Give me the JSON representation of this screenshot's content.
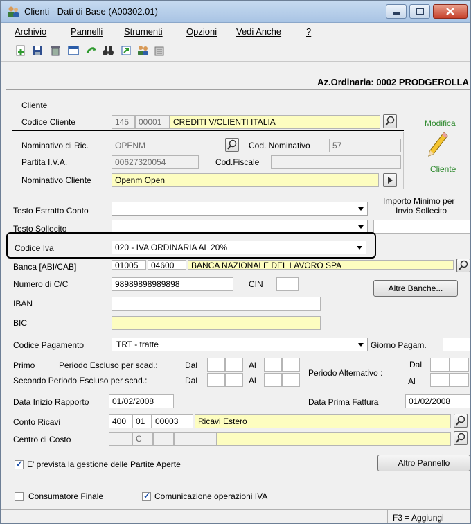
{
  "window": {
    "title": "Clienti - Dati di Base  (A00302.01)"
  },
  "menu": {
    "items": [
      "Archivio",
      "Pannelli",
      "Strumenti",
      "Opzioni",
      "Vedi Anche",
      "?"
    ]
  },
  "toolbar": {
    "icons": [
      "new-icon",
      "save-icon",
      "delete-icon",
      "window-icon",
      "refresh-icon",
      "binoculars-icon",
      "export-icon",
      "users-icon",
      "archive-icon"
    ]
  },
  "company": "Az.Ordinaria: 0002 PRODGEROLLA",
  "cliente": {
    "section_label": "Cliente",
    "codice_label": "Codice Cliente",
    "codice_1": "145",
    "codice_2": "00001",
    "codice_desc": "CREDITI V/CLIENTI ITALIA",
    "nominativo_ric_label": "Nominativo di Ric.",
    "nominativo_ric": "OPENM",
    "cod_nominativo_label": "Cod. Nominativo",
    "cod_nominativo": "57",
    "piva_label": "Partita I.V.A.",
    "piva": "00627320054",
    "codfiscale_label": "Cod.Fiscale",
    "codfiscale": "",
    "nominativo_cliente_label": "Nominativo Cliente",
    "nominativo_cliente": "Openm Open",
    "modifica_label": "Modifica",
    "cliente_label": "Cliente"
  },
  "form": {
    "estratto_label": "Testo Estratto Conto",
    "estratto_value": "",
    "importo_label_1": "Importo Minimo per",
    "importo_label_2": "Invio Sollecito",
    "importo_value": "",
    "sollecito_label": "Testo Sollecito",
    "sollecito_value": "",
    "iva_label": "Codice Iva",
    "iva_value": "020 - IVA ORDINARIA AL 20%",
    "banca_label": "Banca [ABI/CAB]",
    "banca_abi": "01005",
    "banca_cab": "04600",
    "banca_desc": "BANCA NAZIONALE DEL LAVORO SPA",
    "cc_label": "Numero di C/C",
    "cc_value": "98989898989898",
    "cin_label": "CIN",
    "cin_value": "",
    "altre_banche": "Altre Banche...",
    "iban_label": "IBAN",
    "iban_value": "",
    "bic_label": "BIC",
    "bic_value": "",
    "pagamento_label": "Codice Pagamento",
    "pagamento_value": "TRT - tratte",
    "giorno_label": "Giorno Pagam.",
    "giorno_value": "",
    "primo_label": "Primo",
    "periodo1_label": "Periodo Escluso per scad.:",
    "secondo_label": "Secondo Periodo Escluso per scad.:",
    "dal": "Dal",
    "al": "Al",
    "alternativo_label": "Periodo Alternativo :",
    "data_inizio_label": "Data Inizio Rapporto",
    "data_inizio": "01/02/2008",
    "data_prima_label": "Data Prima Fattura",
    "data_prima": "01/02/2008",
    "conto_label": "Conto Ricavi",
    "conto_1": "400",
    "conto_2": "01",
    "conto_3": "00003",
    "conto_desc": "Ricavi Estero",
    "centro_label": "Centro di Costo",
    "centro_1": "",
    "centro_2": "C",
    "centro_3": "",
    "centro_desc": "",
    "partite_label": "E' prevista la gestione delle Partite Aperte",
    "altro_pannello": "Altro Pannello",
    "consumatore_label": "Consumatore Finale",
    "comunicazione_label": "Comunicazione operazioni IVA"
  },
  "status": {
    "hint": "F3 = Aggiungi"
  }
}
